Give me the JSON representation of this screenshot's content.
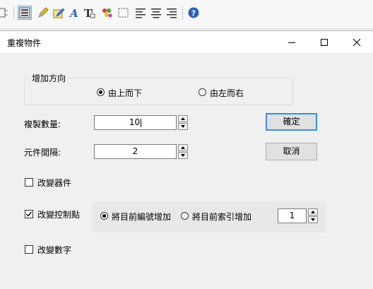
{
  "window": {
    "title": "重複物件"
  },
  "direction_group": {
    "legend": "增加方向",
    "options": [
      "由上而下",
      "由左而右"
    ],
    "selected": "由上而下"
  },
  "copy_count": {
    "label": "複製數量:",
    "value": "10"
  },
  "spacing": {
    "label": "元件間隔:",
    "value": "2"
  },
  "buttons": {
    "ok": "確定",
    "cancel": "取消"
  },
  "change_part": {
    "label": "改變器件",
    "checked": false
  },
  "change_pin": {
    "label": "改變控制點",
    "checked": true,
    "options": [
      "將目前編號增加",
      "將目前索引增加"
    ],
    "selected": "將目前編號增加",
    "step_value": "1"
  },
  "change_number": {
    "label": "改變數字",
    "checked": false
  },
  "toolbar": {
    "icons": [
      "component-icon",
      "list-icon",
      "pencil-icon",
      "edit-icon",
      "text-icon",
      "text-format-icon",
      "palette-icon",
      "select-area-icon",
      "align-left-icon",
      "align-center-icon",
      "align-right-icon",
      "help-icon"
    ]
  },
  "colors": {
    "accent": "#3d8ee0",
    "help": "#2a5fb8"
  }
}
